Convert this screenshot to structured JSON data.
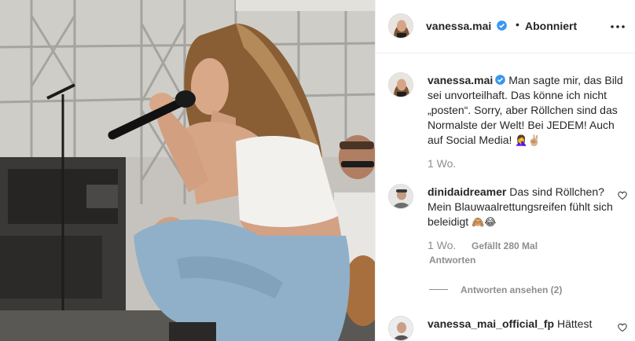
{
  "post": {
    "author": "vanessa.mai",
    "follow_status": "Abonniert",
    "separator": "•",
    "more_icon": "three-dots-icon",
    "verified_icon": "verified-badge-icon",
    "accent_color": "#3897f0"
  },
  "caption": {
    "author": "vanessa.mai",
    "text": "Man sagte mir, das Bild sei unvorteilhaft. Das könne ich nicht „posten“. Sorry, aber Röllchen sind das Normalste der Welt! Bei JEDEM! Auch auf Social Media!",
    "emoji": "🤦‍♀️✌🏼",
    "age": "1 Wo."
  },
  "comments": [
    {
      "author": "dinidaidreamer",
      "text": "Das sind Röllchen? Mein Blauwaalrettungsreifen fühlt sich beleidigt",
      "emoji": "🙈😂",
      "age": "1 Wo.",
      "likes": "Gefällt 280 Mal",
      "reply": "Antworten",
      "view_replies": "Antworten ansehen (2)"
    },
    {
      "author": "vanessa_mai_official_fp",
      "text": "Hättest"
    }
  ]
}
